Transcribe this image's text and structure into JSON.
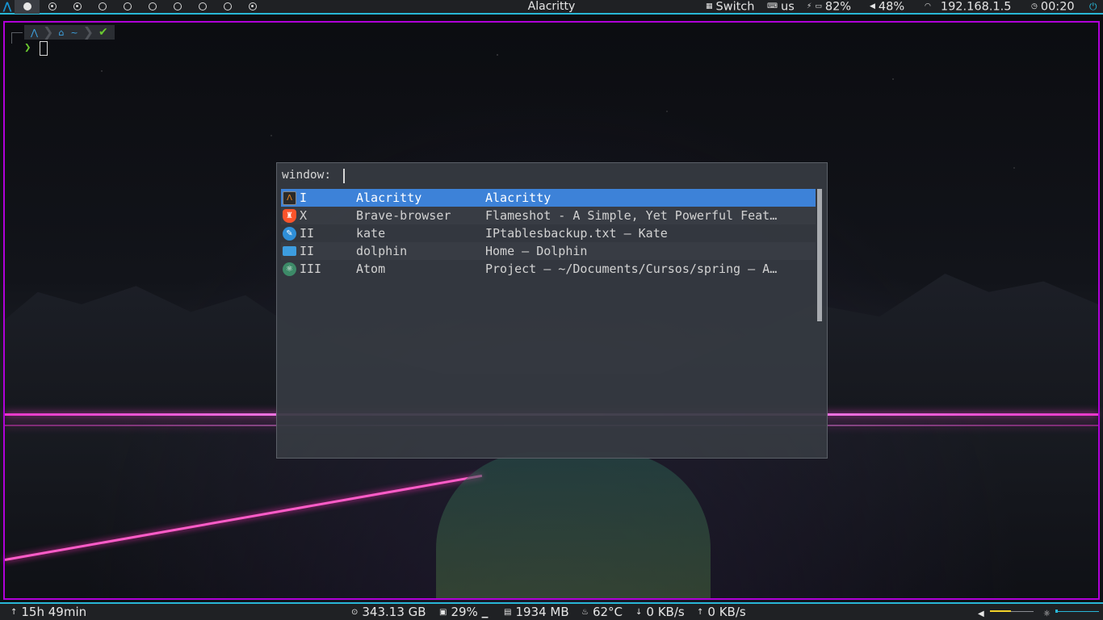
{
  "topbar": {
    "logo_glyph": "⋀",
    "workspaces": [
      {
        "state": "active"
      },
      {
        "state": "occupied"
      },
      {
        "state": "occupied"
      },
      {
        "state": "empty"
      },
      {
        "state": "empty"
      },
      {
        "state": "empty"
      },
      {
        "state": "empty"
      },
      {
        "state": "empty"
      },
      {
        "state": "empty"
      },
      {
        "state": "occupied"
      }
    ],
    "window_title": "Alacritty",
    "layout": "Switch",
    "keyboard": "us",
    "battery": "82%",
    "volume": "48%",
    "ip": "192.168.1.5",
    "time": "00:20",
    "accent_color": "#28b6d6"
  },
  "terminal": {
    "prompt_segments": [
      "⋀",
      "⌂",
      "~",
      "✔"
    ],
    "prompt_arrow": "❯",
    "frame_color": "#b000d8"
  },
  "rofi": {
    "prompt": "window:",
    "selected_color": "#3d82d8",
    "items": [
      {
        "icon": "alacritty-icon",
        "ws": "I",
        "class": "Alacritty",
        "title": "Alacritty",
        "selected": true
      },
      {
        "icon": "brave-icon",
        "ws": "X",
        "class": "Brave-browser",
        "title": "Flameshot - A Simple, Yet Powerful Feat…",
        "selected": false
      },
      {
        "icon": "kate-icon",
        "ws": "II",
        "class": "kate",
        "title": "IPtablesbackup.txt  — Kate",
        "selected": false
      },
      {
        "icon": "dolphin-icon",
        "ws": "II",
        "class": "dolphin",
        "title": "Home — Dolphin",
        "selected": false
      },
      {
        "icon": "atom-icon",
        "ws": "III",
        "class": "Atom",
        "title": "Project — ~/Documents/Cursos/spring — A…",
        "selected": false
      }
    ]
  },
  "bottombar": {
    "uptime": "15h 49min",
    "disk": "343.13 GB",
    "cpu": "29%",
    "cpu_graph": "▁",
    "memory": "1934 MB",
    "temp": "62°C",
    "down": "0 KB/s",
    "up": "0 KB/s",
    "volume_level": 0.48,
    "brightness_level": 0.0
  }
}
